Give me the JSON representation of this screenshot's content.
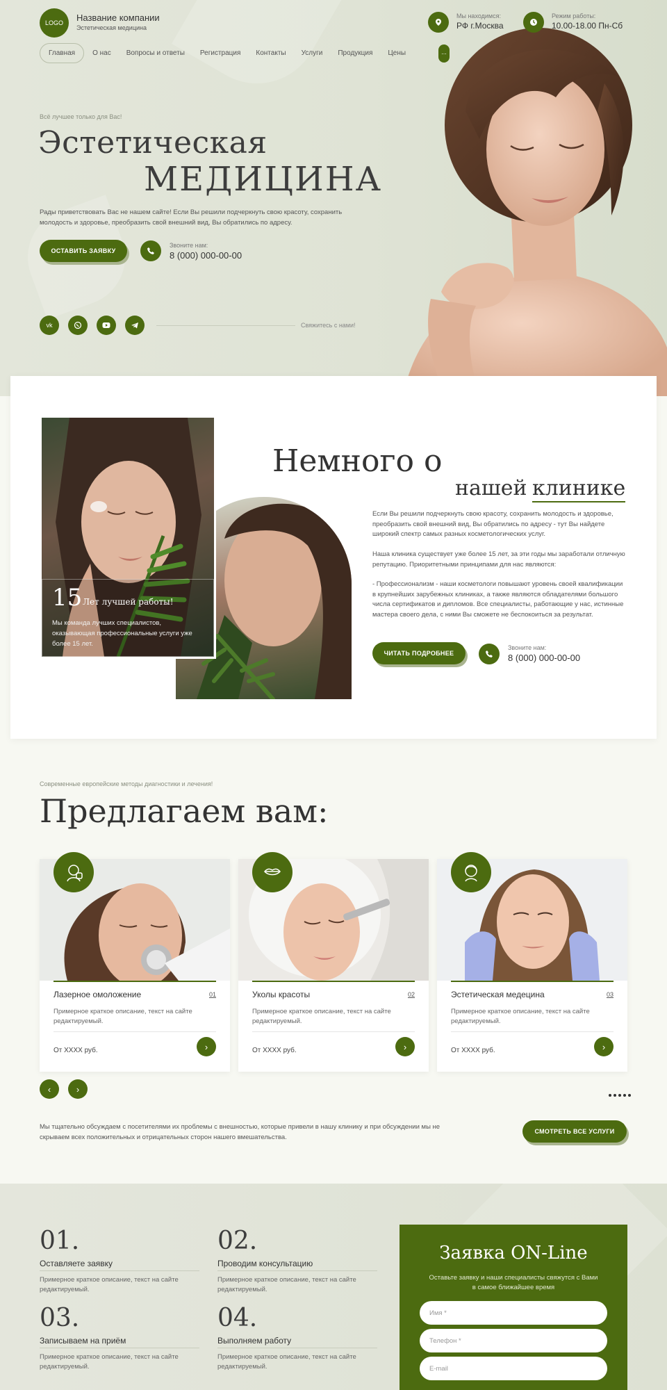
{
  "header": {
    "logo": "LOGO",
    "company_name": "Название компании",
    "company_sub": "Эстетическая медицина",
    "location_label": "Мы находимся:",
    "location_value": "РФ г.Москва",
    "hours_label": "Режим работы:",
    "hours_value": "10.00-18.00 Пн-Сб"
  },
  "nav": {
    "items": [
      "Главная",
      "О нас",
      "Вопросы и ответы",
      "Регистрация",
      "Контакты",
      "Услуги",
      "Продукция",
      "Цены"
    ],
    "more": "..."
  },
  "hero": {
    "tagline": "Всё лучшее только для Вас!",
    "title_line1": "Эстетическая",
    "title_line2": "МЕДИЦИНА",
    "text": "Рады приветствовать Вас не нашем сайте! Если Вы решили подчеркнуть свою красоту, сохранить молодость и здоровье, преобразить свой внешний вид, Вы обратились по адресу.",
    "cta": "ОСТАВИТЬ ЗАЯВКУ",
    "call_label": "Звоните нам:",
    "phone": "8 (000) 000-00-00",
    "socials": [
      "vk",
      "wa",
      "yt",
      "tg"
    ],
    "contact_us": "Свяжитесь с нами!"
  },
  "about": {
    "title_line1": "Немного о",
    "title_line2a": "нашей",
    "title_line2b": "клинике",
    "years_num": "15",
    "years_label": "Лет лучшей работы!",
    "years_text": "Мы команда лучших специалистов, оказывающая профессиональные услуги уже более 15 лет.",
    "p1": "Если Вы решили подчеркнуть свою красоту, сохранить молодость и здоровье, преобразить свой внешний вид, Вы обратились по адресу - тут Вы найдете широкий спектр самых разных косметологических услуг.",
    "p2": "Наша клиника существует уже более 15 лет, за эти годы мы заработали отличную репутацию. Приоритетными принципами для нас являются:",
    "p3": "- Профессионализм - наши косметологи повышают уровень своей квалификации в крупнейших зарубежных клиниках, а также являются обладателями большого числа сертификатов и дипломов. Все специалисты, работающие у нас, истинные мастера своего дела, с ними Вы сможете не беспокоиться за результат.",
    "cta": "ЧИТАТЬ ПОДРОБНЕЕ",
    "call_label": "Звоните нам:",
    "phone": "8 (000) 000-00-00"
  },
  "services": {
    "tagline": "Современные европейские методы диагностики и лечения!",
    "title": "Предлагаем вам:",
    "cards": [
      {
        "title": "Лазерное омоложение",
        "num": "01",
        "desc": "Примерное краткое описание, текст на сайте редактируемый.",
        "price": "От XXXX руб."
      },
      {
        "title": "Уколы красоты",
        "num": "02",
        "desc": "Примерное краткое описание, текст на сайте редактируемый.",
        "price": "От XXXX руб."
      },
      {
        "title": "Эстетическая медецина",
        "num": "03",
        "desc": "Примерное краткое описание, текст на сайте редактируемый.",
        "price": "От XXXX руб."
      }
    ],
    "text": "Мы тщательно обсуждаем с посетителями их проблемы с внешностью, которые привели в нашу клинику и при обсуждении мы не скрываем всех положительных и отрицательных сторон нашего вмешательства.",
    "cta": "СМОТРЕТЬ ВСЕ УСЛУГИ"
  },
  "steps": [
    {
      "num": "01.",
      "title": "Оставляете заявку",
      "desc": "Примерное краткое описание, текст на сайте редактируемый."
    },
    {
      "num": "02.",
      "title": "Проводим консультацию",
      "desc": "Примерное краткое описание, текст на сайте редактируемый."
    },
    {
      "num": "03.",
      "title": "Записываем на приём",
      "desc": "Примерное краткое описание, текст на сайте редактируемый."
    },
    {
      "num": "04.",
      "title": "Выполняем работу",
      "desc": "Примерное краткое описание, текст на сайте редактируемый."
    }
  ],
  "form": {
    "title": "Заявка ON-Line",
    "subtitle": "Оставьте заявку и наши специалисты свяжутся с Вами в самое ближайшее время",
    "name_placeholder": "Имя *",
    "phone_placeholder": "Телефон *",
    "email_placeholder": "E-mail"
  },
  "colors": {
    "accent": "#4c6b10",
    "hero_bg": "#e0e4d7",
    "page_bg": "#f7f8f2"
  }
}
